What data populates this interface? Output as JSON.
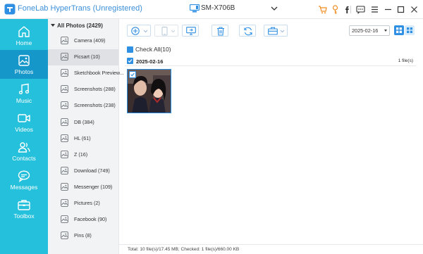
{
  "app": {
    "title": "FoneLab HyperTrans (Unregistered)"
  },
  "device": {
    "name": "SM-X706B"
  },
  "titlebar_icons": [
    "cart-icon",
    "key-icon",
    "facebook-icon",
    "feedback-icon",
    "menu-icon",
    "minimize-icon",
    "maximize-icon",
    "close-icon"
  ],
  "sidebar": {
    "items": [
      {
        "label": "Home",
        "icon": "home-icon"
      },
      {
        "label": "Photos",
        "icon": "photos-icon",
        "active": true
      },
      {
        "label": "Music",
        "icon": "music-icon"
      },
      {
        "label": "Videos",
        "icon": "videos-icon"
      },
      {
        "label": "Contacts",
        "icon": "contacts-icon"
      },
      {
        "label": "Messages",
        "icon": "messages-icon"
      },
      {
        "label": "Toolbox",
        "icon": "toolbox-icon"
      }
    ]
  },
  "albums": {
    "header": "All Photos (2429)",
    "items": [
      {
        "label": "Camera (409)"
      },
      {
        "label": "Picsart (10)",
        "active": true
      },
      {
        "label": "Sketchbook Preview..."
      },
      {
        "label": "Screenshots (288)"
      },
      {
        "label": "Screenshots (238)"
      },
      {
        "label": "DB (384)"
      },
      {
        "label": "HL (61)"
      },
      {
        "label": "Z (16)"
      },
      {
        "label": "Download (749)"
      },
      {
        "label": "Messenger (109)"
      },
      {
        "label": "Pictures (2)"
      },
      {
        "label": "Facebook (90)"
      },
      {
        "label": "Pins (8)"
      }
    ]
  },
  "toolbar": {
    "buttons": [
      "add-icon",
      "export-to-device-icon",
      "export-to-pc-icon",
      "delete-icon",
      "refresh-icon",
      "toolbox-icon"
    ],
    "date_value": "2025-02-16"
  },
  "content": {
    "check_all": "Check All(10)",
    "groups": [
      {
        "date": "2025-02-16",
        "count": "1 file(s)"
      }
    ]
  },
  "status": {
    "text": "Total: 10 file(s)/17.45 MB; Checked: 1 file(s)/660.00 KB"
  },
  "colors": {
    "sidebar": "#25c0db",
    "sidebar_active": "#1597c9",
    "accent": "#2f8fe3",
    "title": "#3b8fd9"
  }
}
